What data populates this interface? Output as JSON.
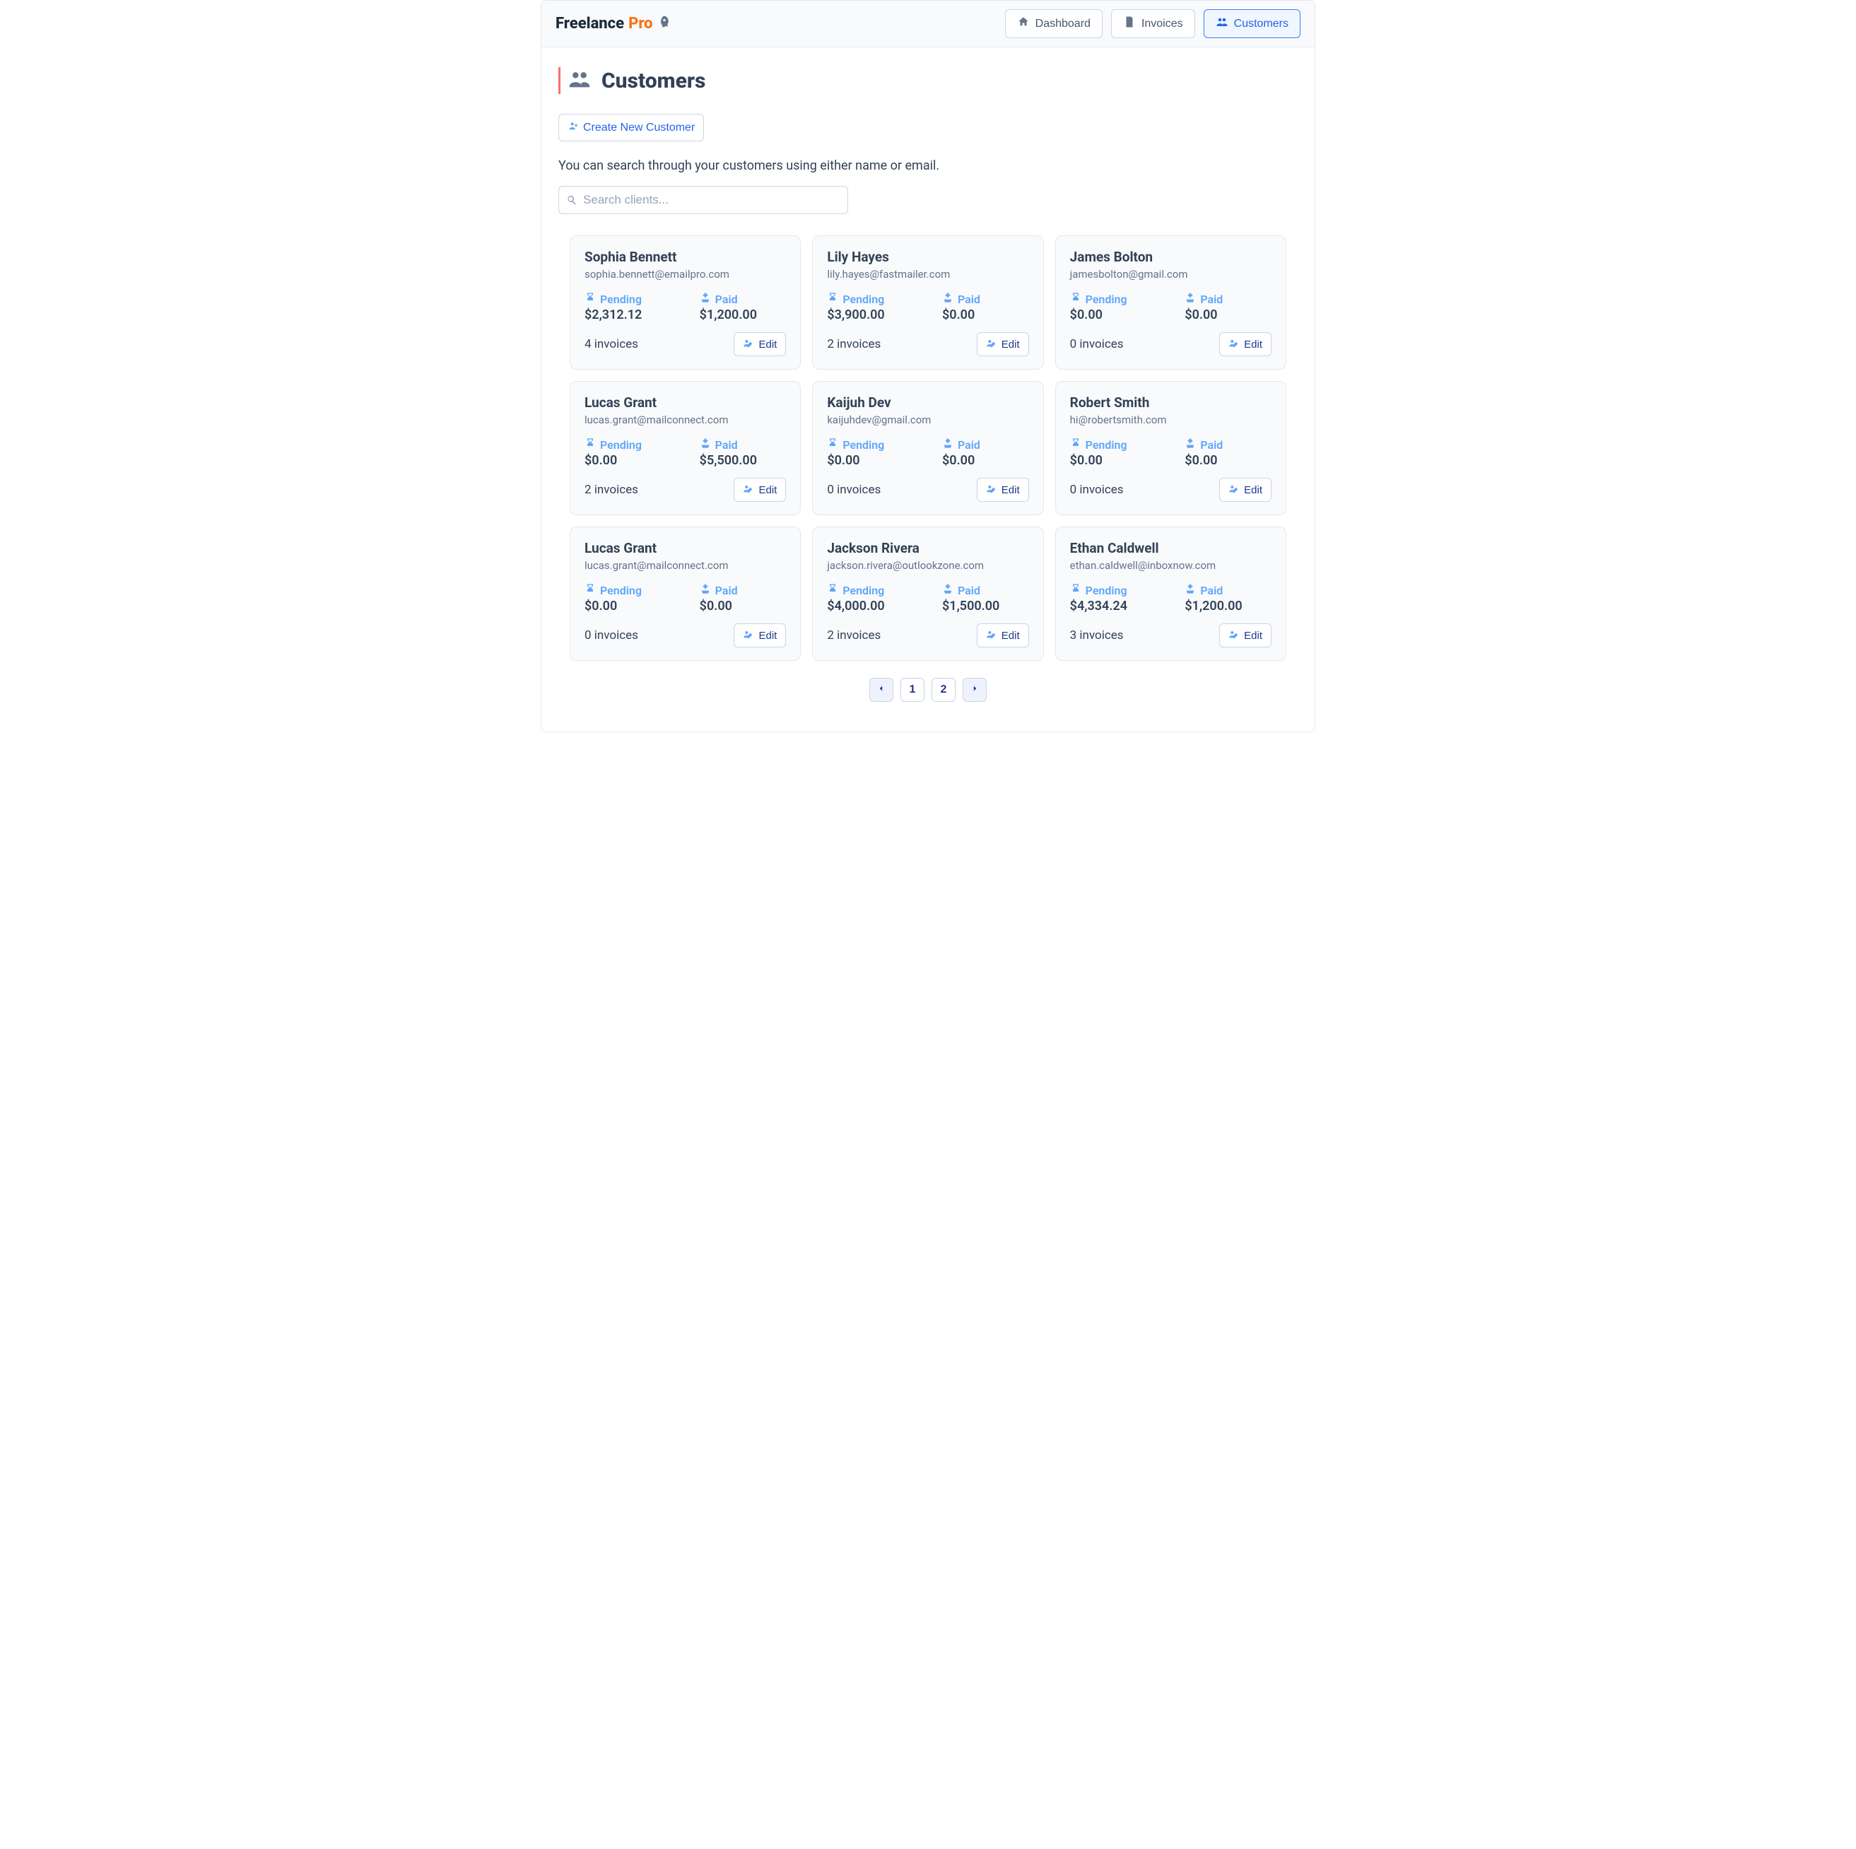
{
  "brand": {
    "name": "Freelance",
    "suffix": "Pro"
  },
  "nav": {
    "dashboard": "Dashboard",
    "invoices": "Invoices",
    "customers": "Customers"
  },
  "page": {
    "title": "Customers",
    "create_label": "Create New Customer",
    "help_text": "You can search through your customers using either name or email.",
    "search_placeholder": "Search clients..."
  },
  "labels": {
    "pending": "Pending",
    "paid": "Paid",
    "edit": "Edit"
  },
  "customers": [
    {
      "name": "Sophia Bennett",
      "email": "sophia.bennett@emailpro.com",
      "pending": "$2,312.12",
      "paid": "$1,200.00",
      "invoices": "4 invoices"
    },
    {
      "name": "Lily Hayes",
      "email": "lily.hayes@fastmailer.com",
      "pending": "$3,900.00",
      "paid": "$0.00",
      "invoices": "2 invoices"
    },
    {
      "name": "James Bolton",
      "email": "jamesbolton@gmail.com",
      "pending": "$0.00",
      "paid": "$0.00",
      "invoices": "0 invoices"
    },
    {
      "name": "Lucas Grant",
      "email": "lucas.grant@mailconnect.com",
      "pending": "$0.00",
      "paid": "$5,500.00",
      "invoices": "2 invoices"
    },
    {
      "name": "Kaijuh Dev",
      "email": "kaijuhdev@gmail.com",
      "pending": "$0.00",
      "paid": "$0.00",
      "invoices": "0 invoices"
    },
    {
      "name": "Robert Smith",
      "email": "hi@robertsmith.com",
      "pending": "$0.00",
      "paid": "$0.00",
      "invoices": "0 invoices"
    },
    {
      "name": "Lucas Grant",
      "email": "lucas.grant@mailconnect.com",
      "pending": "$0.00",
      "paid": "$0.00",
      "invoices": "0 invoices"
    },
    {
      "name": "Jackson Rivera",
      "email": "jackson.rivera@outlookzone.com",
      "pending": "$4,000.00",
      "paid": "$1,500.00",
      "invoices": "2 invoices"
    },
    {
      "name": "Ethan Caldwell",
      "email": "ethan.caldwell@inboxnow.com",
      "pending": "$4,334.24",
      "paid": "$1,200.00",
      "invoices": "3 invoices"
    }
  ],
  "pagination": {
    "pages": [
      "1",
      "2"
    ],
    "current": "1"
  }
}
